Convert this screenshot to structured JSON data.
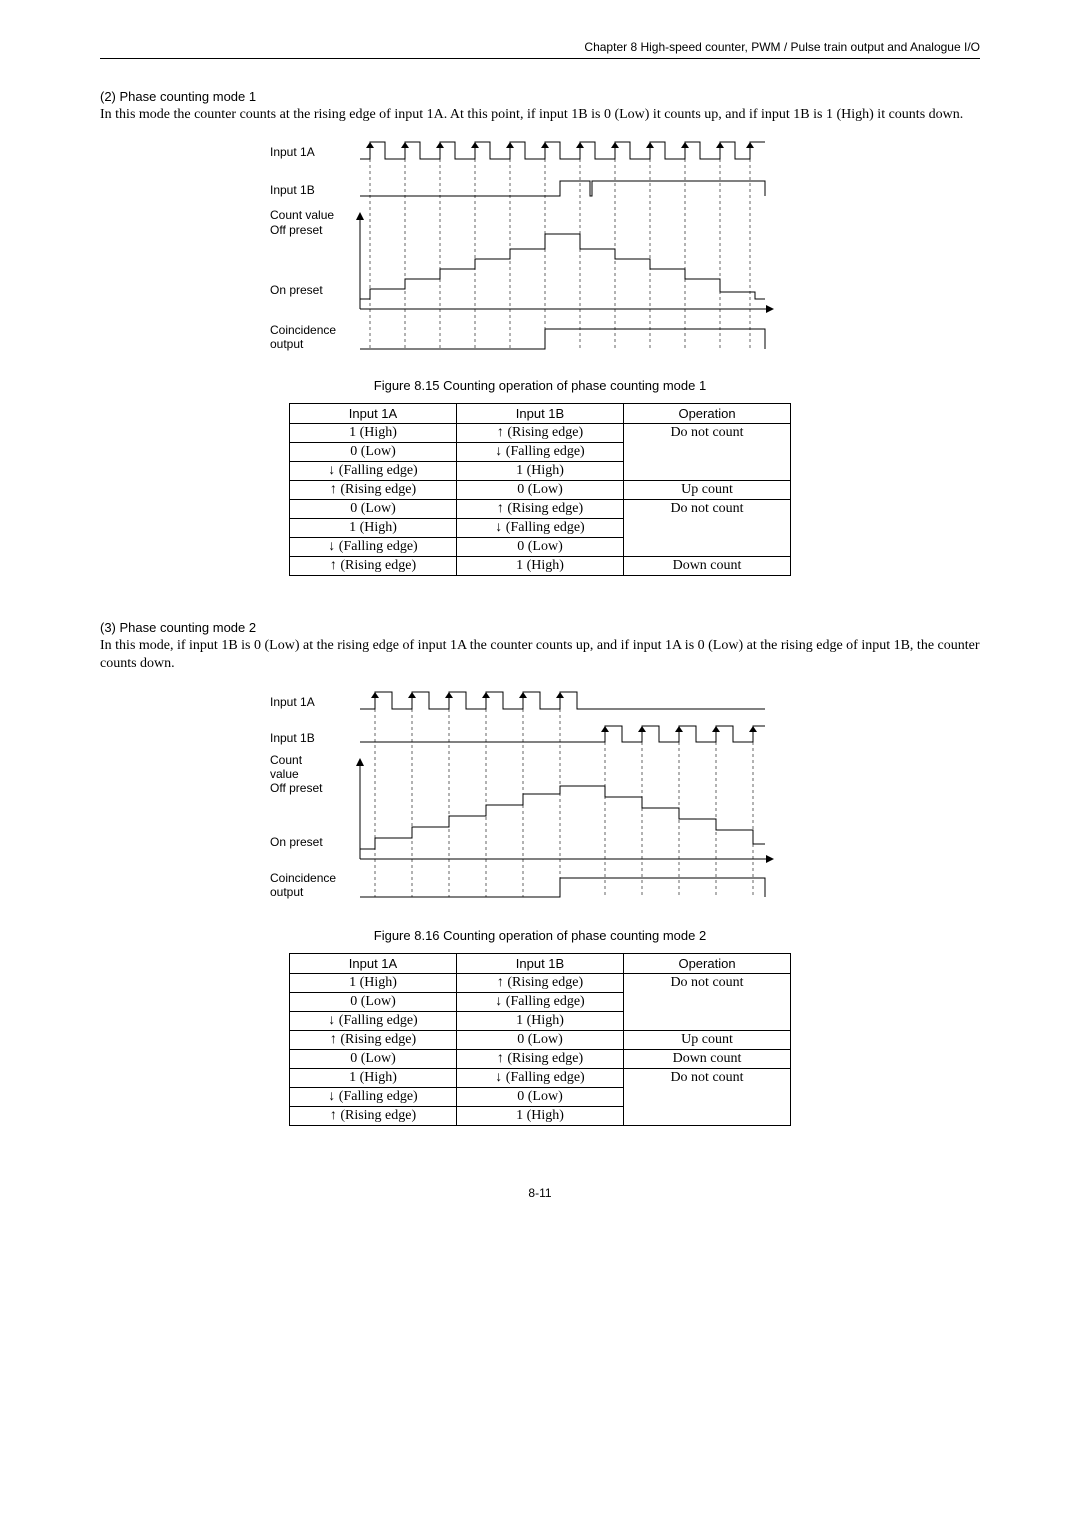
{
  "header": "Chapter 8  High-speed counter, PWM / Pulse train output and Analogue I/O",
  "sec2": {
    "title": "(2)   Phase counting mode 1",
    "body": "In this mode the counter counts at the rising edge of input 1A. At this point, if input 1B is 0 (Low) it counts up, and if input 1B is 1 (High) it counts down."
  },
  "sec3": {
    "title": "(3)   Phase counting mode 2",
    "body": "In this mode, if input 1B is 0 (Low) at the rising edge of input 1A the counter counts up, and if input 1A is 0 (Low) at the rising edge of input 1B, the counter counts down."
  },
  "fig15": "Figure 8.15 Counting operation of phase counting mode 1",
  "fig16": "Figure 8.16 Counting operation of phase counting mode 2",
  "tbl_hdr": {
    "a": "Input 1A",
    "b": "Input 1B",
    "c": "Operation"
  },
  "t1": {
    "r0": {
      "a": "1 (High)",
      "b": "↑ (Rising edge)",
      "c": "Do not count"
    },
    "r1": {
      "a": "0 (Low)",
      "b": "↓ (Falling edge)",
      "c": ""
    },
    "r2": {
      "a": "↓ (Falling edge)",
      "b": "1 (High)",
      "c": ""
    },
    "r3": {
      "a": "↑ (Rising edge)",
      "b": "0 (Low)",
      "c": "Up count"
    },
    "r4": {
      "a": "0 (Low)",
      "b": "↑ (Rising edge)",
      "c": "Do not count"
    },
    "r5": {
      "a": "1 (High)",
      "b": "↓ (Falling edge)",
      "c": ""
    },
    "r6": {
      "a": "↓ (Falling edge)",
      "b": "0 (Low)",
      "c": ""
    },
    "r7": {
      "a": "↑ (Rising edge)",
      "b": "1 (High)",
      "c": "Down count"
    }
  },
  "t2": {
    "r0": {
      "a": "1 (High)",
      "b": "↑ (Rising edge)",
      "c": "Do not count"
    },
    "r1": {
      "a": "0 (Low)",
      "b": "↓ (Falling edge)",
      "c": ""
    },
    "r2": {
      "a": "↓ (Falling edge)",
      "b": "1 (High)",
      "c": ""
    },
    "r3": {
      "a": "↑ (Rising edge)",
      "b": "0 (Low)",
      "c": "Up count"
    },
    "r4": {
      "a": "0 (Low)",
      "b": "↑ (Rising edge)",
      "c": "Down count"
    },
    "r5": {
      "a": "1 (High)",
      "b": "↓ (Falling edge)",
      "c": "Do not count"
    },
    "r6": {
      "a": "↓ (Falling edge)",
      "b": "0 (Low)",
      "c": ""
    },
    "r7": {
      "a": "↑ (Rising edge)",
      "b": "1 (High)",
      "c": ""
    }
  },
  "diag_labels": {
    "in1a": "Input 1A",
    "in1b": "Input 1B",
    "count_val": "Count value",
    "count": "Count",
    "value": "value",
    "off": "Off preset",
    "on": "On preset",
    "coin": "Coincidence",
    "out": "output"
  },
  "page": "8-11",
  "chart_data": [
    {
      "type": "timing-diagram",
      "title": "Counting operation of phase counting mode 1",
      "signals": [
        {
          "name": "Input 1A",
          "type": "digital",
          "pattern": "11 pulses, evenly spaced"
        },
        {
          "name": "Input 1B",
          "type": "digital",
          "pattern": "low for first half, high for second half, with small jitter"
        },
        {
          "name": "Count value",
          "type": "analog-step",
          "pattern": "ramps up from On preset toward Off preset over first 6 pulses then down again",
          "ylabels": [
            "Off preset",
            "On preset"
          ]
        },
        {
          "name": "Coincidence output",
          "type": "digital",
          "pattern": "low, goes high after count reaches threshold near 6th pulse, stays high"
        }
      ]
    },
    {
      "type": "timing-diagram",
      "title": "Counting operation of phase counting mode 2",
      "signals": [
        {
          "name": "Input 1A",
          "type": "digital",
          "pattern": "6 pulses then low"
        },
        {
          "name": "Input 1B",
          "type": "digital",
          "pattern": "low first half, 5 pulses second half"
        },
        {
          "name": "Count value",
          "type": "analog-step",
          "pattern": "ramps up to Off preset over 6 pulses, ramps down during 1B pulses",
          "ylabels": [
            "Off preset",
            "On preset"
          ]
        },
        {
          "name": "Coincidence output",
          "type": "digital",
          "pattern": "low then high after 6th 1A pulse, stays high"
        }
      ]
    }
  ]
}
